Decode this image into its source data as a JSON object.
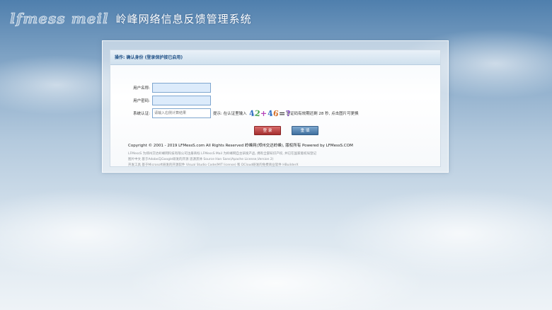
{
  "brand": {
    "logo_text": "lfmess meil",
    "title": "岭峰网络信息反馈管理系统"
  },
  "panel": {
    "header": "操作: 确认身份  (登录保护接已启用)"
  },
  "form": {
    "username_label": "用户名称:",
    "username_value": "",
    "password_label": "用户密码:",
    "password_value": "",
    "captcha_label": "系统认证:",
    "captcha_placeholder": "请输入右侧计算结果",
    "tip_prefix": "提示:  在认证里输入",
    "captcha_chars": [
      "4",
      "2",
      "+",
      "4",
      "6",
      "=",
      "?"
    ],
    "tip_suffix": "验证码有效期还剩 28 秒,  点击图片可更换"
  },
  "buttons": {
    "login": "登 录",
    "reset": "重 填"
  },
  "footer": {
    "copyright": "Copyright © 2001 - 2019 LFMessS.com All Rights Reserved 岭峰网(郑州交达岭峰), 版权所有 Powered by LFMessS.COM",
    "notes": [
      "LFMessS  为郑州交达岭峰网科技有限公司注册商标    LFMessS  Mail  为岭峰网自主研发产品,  拥有全部知识产权,  并已在国家版权局登记",
      "图片中文  基于Adobe与Google研发的开源  思源黑体  Source Han Sans(Apache License,Version 2)",
      "开发工具  基于Microsoft研发的开源软件  Visual Studio Code(MIT license)  和  DCloud研发的免费商业软件  HBuilderX"
    ]
  },
  "colors": {
    "header_text": "#1e4f86",
    "captcha_colors": [
      "#2d6cc0",
      "#3fa14a",
      "#b33fb8",
      "#2d6cc0",
      "#d6702a",
      "#444444",
      "#7d3fbf"
    ],
    "login_button": "#a42f2f",
    "reset_button": "#3f6f9e"
  }
}
